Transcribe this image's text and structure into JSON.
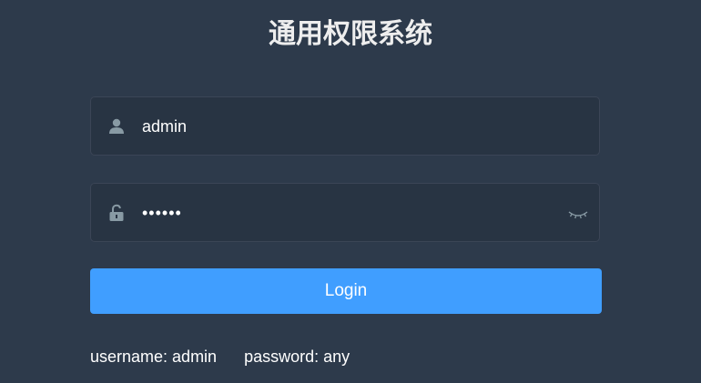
{
  "title": "通用权限系统",
  "form": {
    "username": {
      "value": "admin",
      "icon": "user-icon"
    },
    "password": {
      "value": "••••••",
      "icon": "lock-icon",
      "toggle_icon": "eye-closed-icon"
    },
    "login_label": "Login"
  },
  "tips": {
    "username": "username: admin",
    "password": "password: any"
  },
  "colors": {
    "background": "#2d3a4b",
    "input_background": "#283443",
    "icon": "#889aa4",
    "primary": "#409eff"
  }
}
